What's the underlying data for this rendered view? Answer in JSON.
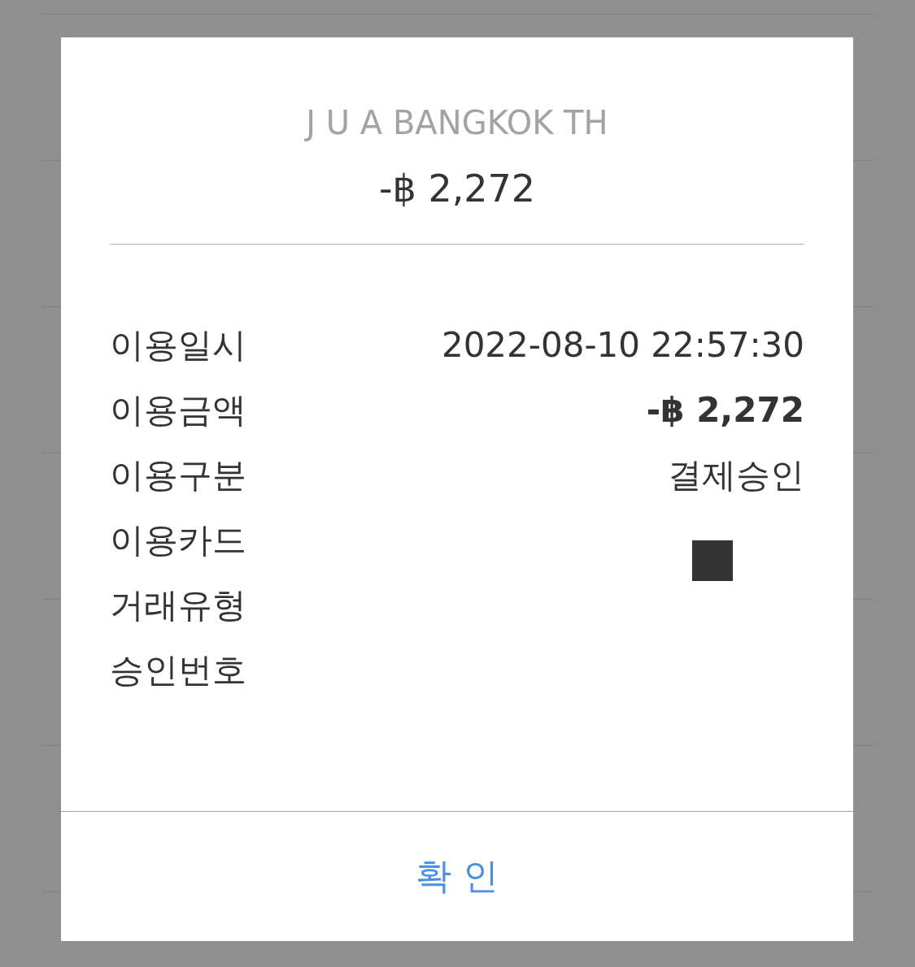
{
  "dialog": {
    "merchant": "J U A BANGKOK TH",
    "amount": "-฿ 2,272",
    "details": [
      {
        "label": "이용일시",
        "value": "2022-08-10 22:57:30",
        "kind": "text"
      },
      {
        "label": "이용금액",
        "value": "-฿ 2,272",
        "kind": "amount"
      },
      {
        "label": "이용구분",
        "value": "결제승인",
        "kind": "text"
      },
      {
        "label": "이용카드",
        "kind": "redacted"
      },
      {
        "label": "거래유형",
        "kind": "empty"
      },
      {
        "label": "승인번호",
        "kind": "empty"
      }
    ],
    "confirm_button": "확 인"
  }
}
